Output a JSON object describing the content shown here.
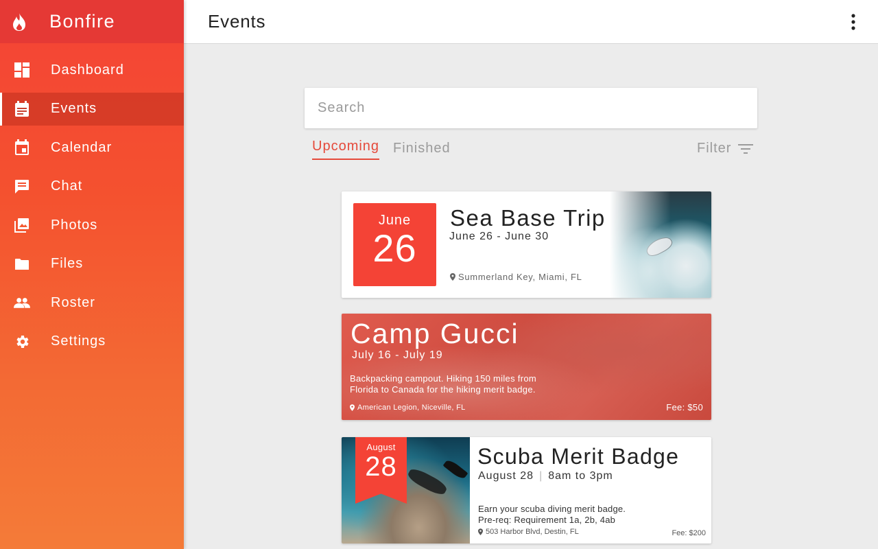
{
  "app": {
    "name": "Bonfire",
    "brand_color": "#f44336"
  },
  "sidebar": {
    "items": [
      {
        "label": "Dashboard",
        "icon": "dashboard-icon",
        "active": false
      },
      {
        "label": "Events",
        "icon": "events-icon",
        "active": true
      },
      {
        "label": "Calendar",
        "icon": "calendar-icon",
        "active": false
      },
      {
        "label": "Chat",
        "icon": "chat-icon",
        "active": false
      },
      {
        "label": "Photos",
        "icon": "photos-icon",
        "active": false
      },
      {
        "label": "Files",
        "icon": "folder-icon",
        "active": false
      },
      {
        "label": "Roster",
        "icon": "people-icon",
        "active": false
      },
      {
        "label": "Settings",
        "icon": "gear-icon",
        "active": false
      }
    ]
  },
  "header": {
    "title": "Events"
  },
  "search": {
    "placeholder": "Search",
    "value": ""
  },
  "tabs": {
    "upcoming": "Upcoming",
    "finished": "Finished",
    "active": "upcoming",
    "filter_label": "Filter"
  },
  "events": [
    {
      "month": "June",
      "day": "26",
      "title": "Sea Base Trip",
      "dates": "June 26 - June 30",
      "location": "Summerland Key, Miami, FL"
    },
    {
      "title": "Camp Gucci",
      "dates": "July 16 - July 19",
      "description_line1": "Backpacking campout. Hiking 150 miles from",
      "description_line2": "Florida to Canada for the hiking merit badge.",
      "location": "American Legion, Niceville, FL",
      "fee": "Fee: $50"
    },
    {
      "month": "August",
      "day": "28",
      "title": "Scuba Merit Badge",
      "date": "August 28",
      "separator": "|",
      "time": "8am to 3pm",
      "description_line1": "Earn your scuba diving merit badge.",
      "description_line2": "Pre-req: Requirement 1a, 2b, 4ab",
      "location": "503 Harbor Blvd, Destin, FL",
      "fee": "Fee: $200"
    }
  ]
}
